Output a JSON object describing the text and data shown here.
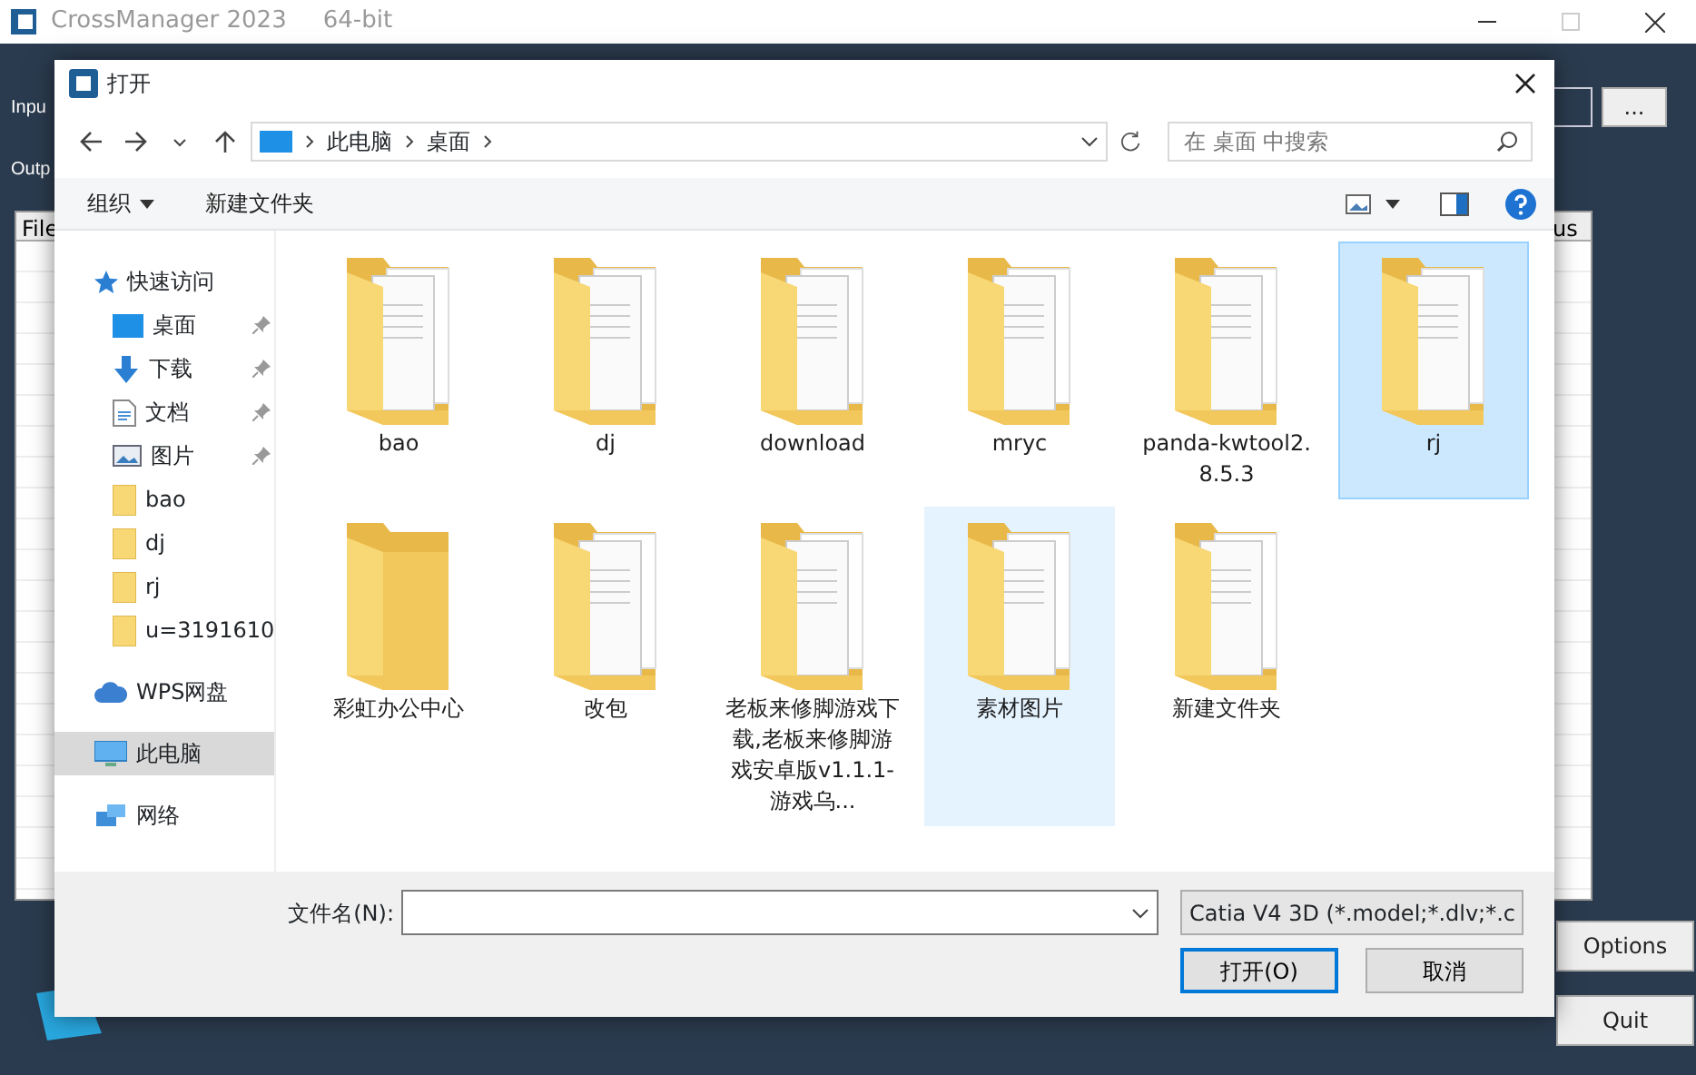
{
  "app": {
    "title": "CrossManager 2023",
    "subtitle": "64-bit",
    "input_label": "Inpu",
    "output_label": "Outp",
    "browse_button": "...",
    "table": {
      "columns": [
        "File",
        "us"
      ]
    },
    "buttons": [
      "Options",
      "Quit"
    ]
  },
  "dialog": {
    "title": "打开",
    "breadcrumb": [
      "此电脑",
      "桌面"
    ],
    "search": {
      "placeholder": "在 桌面 中搜索"
    },
    "toolbar": [
      {
        "label": "组织",
        "kind": "menu"
      },
      {
        "label": "新建文件夹",
        "kind": "plain"
      }
    ],
    "sidebar": [
      {
        "label": "快速访问",
        "kind": "star",
        "selected": false,
        "children": [
          {
            "label": "桌面",
            "kind": "desktop",
            "pinned": true,
            "selected": false
          },
          {
            "label": "下载",
            "kind": "download",
            "pinned": true,
            "selected": false
          },
          {
            "label": "文档",
            "kind": "document",
            "pinned": true,
            "selected": false
          },
          {
            "label": "图片",
            "kind": "picture",
            "pinned": true,
            "selected": false
          },
          {
            "label": "bao",
            "kind": "folder",
            "pinned": false,
            "selected": false
          },
          {
            "label": "dj",
            "kind": "folder",
            "pinned": false,
            "selected": false
          },
          {
            "label": "rj",
            "kind": "folder",
            "pinned": false,
            "selected": false
          },
          {
            "label": "u=3191610",
            "kind": "folder",
            "pinned": false,
            "selected": false
          }
        ]
      },
      {
        "label": "WPS网盘",
        "kind": "cloud",
        "selected": false
      },
      {
        "label": "此电脑",
        "kind": "computer",
        "selected": true
      },
      {
        "label": "网络",
        "kind": "network",
        "selected": false
      }
    ],
    "files": [
      {
        "name": "bao",
        "kind": "files",
        "selected": false,
        "hovered": false
      },
      {
        "name": "dj",
        "kind": "files",
        "selected": false,
        "hovered": false
      },
      {
        "name": "download",
        "kind": "files",
        "selected": false,
        "hovered": false
      },
      {
        "name": "mryc",
        "kind": "files",
        "selected": false,
        "hovered": false
      },
      {
        "name": "panda-kwtool2.8.5.3",
        "kind": "files",
        "selected": false,
        "hovered": false
      },
      {
        "name": "rj",
        "kind": "files",
        "selected": true,
        "hovered": false
      },
      {
        "name": "彩虹办公中心",
        "kind": "empty",
        "selected": false,
        "hovered": false
      },
      {
        "name": "改包",
        "kind": "files",
        "selected": false,
        "hovered": false
      },
      {
        "name": "老板来修脚游戏下载,老板来修脚游戏安卓版v1.1.1-游戏乌...",
        "kind": "files",
        "selected": false,
        "hovered": false
      },
      {
        "name": "素材图片",
        "kind": "files",
        "selected": false,
        "hovered": true
      },
      {
        "name": "新建文件夹",
        "kind": "files",
        "selected": false,
        "hovered": false
      }
    ],
    "filename_label": "文件名(N):",
    "filter": "Catia V4 3D (*.model;*.dlv;*.c",
    "buttons": [
      {
        "label": "打开(O)",
        "default": true
      },
      {
        "label": "取消",
        "default": false
      }
    ]
  }
}
